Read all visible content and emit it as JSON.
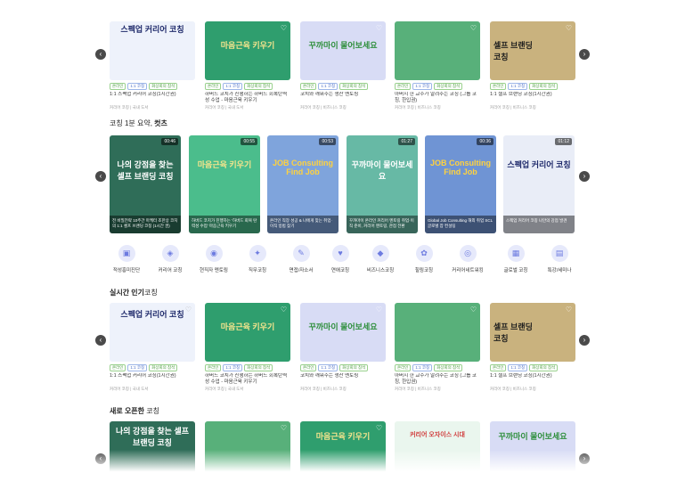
{
  "sections": {
    "shorts_title_prefix": "코칭 1분 요약, ",
    "shorts_title_bold": "컷츠",
    "popular_title_bold": "실시간 인기",
    "popular_title_rest": "코칭",
    "new_title_bold": "새로 오픈한",
    "new_title_rest": " 코칭"
  },
  "top_cards": [
    {
      "thumb_text": "스펙업 커리어 코칭",
      "badges": [
        "온라인",
        "1:1 코칭",
        "화상회의 참석"
      ],
      "title": "1:1 스펙업 커리어 코칭(1시간권)",
      "meta": "커리어 코칭 | 국내 도서"
    },
    {
      "thumb_text": "마음근육 키우기",
      "badges": [
        "온라인",
        "1:1 코칭",
        "화상회의 참석"
      ],
      "title": "하버드 코치가 진행하는 하버드 회복탄력성 수업 - 마음근육 키우기",
      "meta": "커리어 코칭 | 국내 도서"
    },
    {
      "thumb_text": "꾸까마이 물어보세요",
      "badges": [
        "온라인",
        "1:1 코칭",
        "화상회의 참석"
      ],
      "title": "코치와 깨워주는 생산 멘토링",
      "meta": "커리어 코칭 | 비즈니스 코칭"
    },
    {
      "thumb_text": "",
      "badges": [
        "온라인",
        "1:1 코칭",
        "화상회의 참석"
      ],
      "title": "아버지 한 교수가 알려주는 코칭 (그룹 코칭, 한입권)",
      "meta": "커리어 코칭 | 비즈니스 코칭"
    },
    {
      "thumb_text": "셀프 브랜딩 코칭",
      "badges": [
        "온라인",
        "1:1 코칭",
        "화상회의 참석"
      ],
      "title": "1:1 셀프 브랜딩 코칭(1시간권)",
      "meta": "커리어 코칭 | 비즈니스 코칭"
    }
  ],
  "shorts": [
    {
      "duration": "00:46",
      "big": "나의 강점을 찾는 셀프 브랜딩 코칭",
      "caption": "전 비밀전략 10주간 마케터 조한상 코치의 1:1 셀프 브랜딩 코칭 (1시간 권)"
    },
    {
      "duration": "00:55",
      "big": "마음근육 키우기",
      "caption": "하버드 코치가 진행하는 '하버드 회복 탄력성 수업' 마음근육 키우기"
    },
    {
      "duration": "00:53",
      "big": "JOB Consulting Find Job",
      "caption": "온라인 직장 성공 & 나에게 맞는 취업·이직 방법 찾기"
    },
    {
      "duration": "01:27",
      "big": "꾸까마이 물어보세요",
      "caption": "꾸까마이 온라인 커리어 멘토링 취업·이직 준비, 커리어 멘토링, 관점 전환"
    },
    {
      "duration": "00:36",
      "big": "JOB Consulting Find Job",
      "caption": "Global Job Consulting 해외 취업 SCL 글로벌 잡 컨설팅"
    },
    {
      "duration": "01:12",
      "big": "스펙업 커리어 코칭",
      "caption": "스펙업 커리어 코칭 나만의 강점 발견"
    }
  ],
  "categories": [
    {
      "icon": "▣",
      "label": "적성흥미진단"
    },
    {
      "icon": "◈",
      "label": "커리어 코칭"
    },
    {
      "icon": "◉",
      "label": "현직자 멘토링"
    },
    {
      "icon": "✦",
      "label": "직무코칭"
    },
    {
      "icon": "✎",
      "label": "면접/자소서"
    },
    {
      "icon": "♥",
      "label": "연애코칭"
    },
    {
      "icon": "◆",
      "label": "비즈니스코칭"
    },
    {
      "icon": "✿",
      "label": "힐링코칭"
    },
    {
      "icon": "◎",
      "label": "커리어네트워킹"
    },
    {
      "icon": "▦",
      "label": "글로벌 코칭"
    },
    {
      "icon": "▤",
      "label": "특강/세미나"
    }
  ],
  "popular_cards": [
    {
      "thumb_text": "스펙업 커리어 코칭",
      "badges": [
        "온라인",
        "1:1 코칭",
        "화상회의 참석"
      ],
      "title": "1:1 스펙업 커리어 코칭(1시간권)",
      "meta": "커리어 코칭 | 국내 도서"
    },
    {
      "thumb_text": "마음근육 키우기",
      "badges": [
        "온라인",
        "1:1 코칭",
        "화상회의 참석"
      ],
      "title": "하버드 코치가 진행하는 하버드 회복탄력성 수업 - 마음근육 키우기",
      "meta": "커리어 코칭 | 국내 도서"
    },
    {
      "thumb_text": "꾸까마이 물어보세요",
      "badges": [
        "온라인",
        "1:1 코칭",
        "화상회의 참석"
      ],
      "title": "코치와 깨워주는 생산 멘토링",
      "meta": "커리어 코칭 | 비즈니스 코칭"
    },
    {
      "thumb_text": "",
      "badges": [
        "온라인",
        "1:1 코칭",
        "화상회의 참석"
      ],
      "title": "아버지 한 교수가 알려주는 코칭 (그룹 코칭, 한입권)",
      "meta": "커리어 코칭 | 비즈니스 코칭"
    },
    {
      "thumb_text": "셀프 브랜딩 코칭",
      "badges": [
        "온라인",
        "1:1 코칭",
        "화상회의 참석"
      ],
      "title": "1:1 셀프 브랜딩 코칭(1시간권)",
      "meta": "커리어 코칭 | 비즈니스 코칭"
    }
  ],
  "new_cards": [
    {
      "thumb_text": "나의 강점을 찾는 셀프 브랜딩 코칭"
    },
    {
      "thumb_text": ""
    },
    {
      "thumb_text": "마음근육 키우기"
    },
    {
      "thumb_text": "커리어 오자이스 시대"
    },
    {
      "thumb_text": "꾸까마이 물어보세요"
    }
  ]
}
